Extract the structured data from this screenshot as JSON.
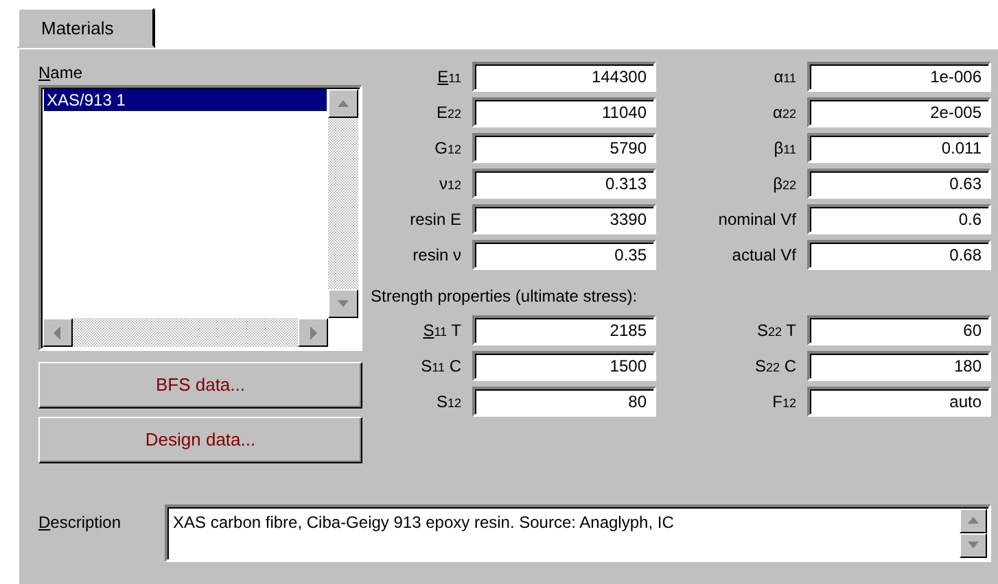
{
  "tabs": [
    {
      "label": "Materials",
      "selected": true
    }
  ],
  "name_list": {
    "label": "Name",
    "mnemonic": true,
    "items": [
      {
        "text": "XAS/913 1",
        "selected": true
      }
    ]
  },
  "buttons": [
    {
      "label": "BFS data..."
    },
    {
      "label": "Design data..."
    }
  ],
  "stiffness_left": [
    {
      "label": "E$_{11}$",
      "mnemonic": true,
      "value": "144300"
    },
    {
      "label": "E$_{22}$",
      "mnemonic": false,
      "value": "11040"
    },
    {
      "label": "G$_{12}$",
      "mnemonic": false,
      "value": "5790"
    },
    {
      "label": "ν$_{12}$",
      "mnemonic": false,
      "value": "0.313"
    },
    {
      "label": "resin E",
      "mnemonic": false,
      "value": "3390"
    },
    {
      "label": "resin ν",
      "mnemonic": false,
      "value": "0.35"
    }
  ],
  "stiffness_right": [
    {
      "label": "α$_{11}$",
      "mnemonic": false,
      "value": "1e-006"
    },
    {
      "label": "α$_{22}$",
      "mnemonic": false,
      "value": "2e-005"
    },
    {
      "label": "β$_{11}$",
      "mnemonic": false,
      "value": "0.011"
    },
    {
      "label": "β$_{22}$",
      "mnemonic": false,
      "value": "0.63"
    },
    {
      "label": "nominal Vf",
      "mnemonic": false,
      "value": "0.6"
    },
    {
      "label": "actual Vf",
      "mnemonic": false,
      "value": "0.68"
    }
  ],
  "strength_heading": "Strength properties (ultimate stress):",
  "strength_left": [
    {
      "label": "S$_{11}$ T",
      "mnemonic": true,
      "value": "2185"
    },
    {
      "label": "S$_{11}$ C",
      "mnemonic": false,
      "value": "1500"
    },
    {
      "label": "S$_{12}$",
      "mnemonic": false,
      "value": "80"
    }
  ],
  "strength_right": [
    {
      "label": "S$_{22}$ T",
      "mnemonic": false,
      "value": "60"
    },
    {
      "label": "S$_{22}$ C",
      "mnemonic": false,
      "value": "180"
    },
    {
      "label": "F$_{12}$",
      "mnemonic": false,
      "value": "auto"
    }
  ],
  "description": {
    "label": "Description",
    "mnemonic": true,
    "value": "XAS carbon fibre, Ciba-Geigy 913 epoxy resin. Source: Anaglyph, IC"
  }
}
